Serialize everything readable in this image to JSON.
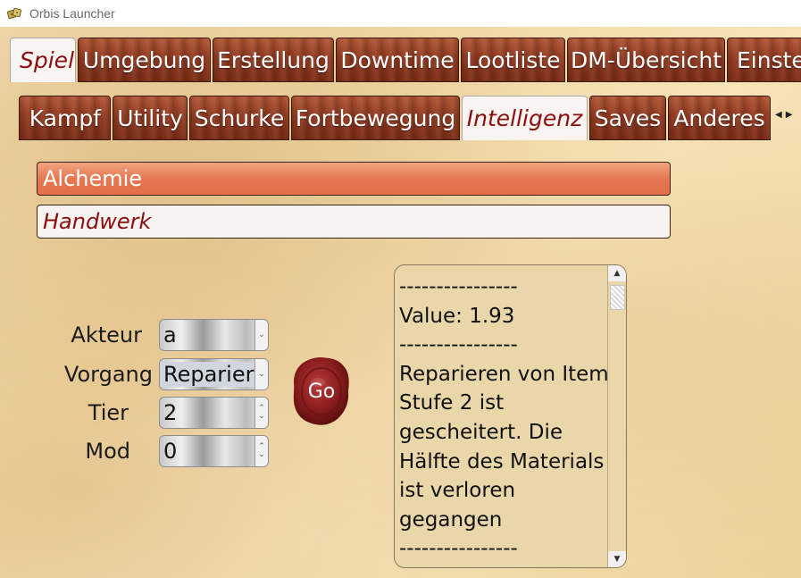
{
  "window": {
    "title": "Orbis Launcher",
    "app_icon": "dice-icon"
  },
  "main_tabs": [
    {
      "label": "Spieler",
      "active": true
    },
    {
      "label": "Umgebung",
      "active": false
    },
    {
      "label": "Erstellung",
      "active": false
    },
    {
      "label": "Downtime",
      "active": false
    },
    {
      "label": "Lootliste",
      "active": false
    },
    {
      "label": "DM-Übersicht",
      "active": false
    },
    {
      "label": "Einstellungen",
      "active": false
    }
  ],
  "sub_tabs": [
    {
      "label": "Kampf",
      "active": false
    },
    {
      "label": "Utility",
      "active": false
    },
    {
      "label": "Schurke",
      "active": false
    },
    {
      "label": "Fortbewegung",
      "active": false
    },
    {
      "label": "Intelligenz",
      "active": true
    },
    {
      "label": "Saves",
      "active": false
    },
    {
      "label": "Anderes",
      "active": false
    }
  ],
  "tab_scroll": {
    "left": "◀",
    "right": "▶"
  },
  "sections": {
    "alchemie": "Alchemie",
    "handwerk": "Handwerk"
  },
  "form": {
    "akteur": {
      "label": "Akteur",
      "value": "a"
    },
    "vorgang": {
      "label": "Vorgang",
      "value": "Reparieren"
    },
    "tier": {
      "label": "Tier",
      "value": "2"
    },
    "mod": {
      "label": "Mod",
      "value": "0"
    }
  },
  "go_button": {
    "label": "Go",
    "icon": "wax-seal-icon"
  },
  "output": {
    "text": "----------------\nValue: 1.93\n----------------\nReparieren von Item Stufe 2 ist gescheitert. Die Hälfte des Materials ist verloren gegangen\n----------------"
  },
  "colors": {
    "tab_wood": "#8e3a22",
    "active_tab_text": "#8b0d0d",
    "alchemie_bar": "#e57851",
    "seal": "#8c1e1e",
    "output_bg": "#e9d7a9"
  }
}
